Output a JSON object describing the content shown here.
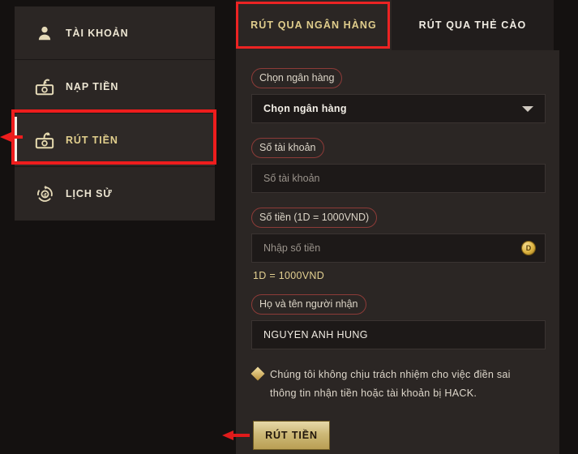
{
  "theme": {
    "page_bg": "#141110",
    "panel_bg": "#2b2624",
    "input_bg": "#1d1918",
    "gold": "#e2cf8d",
    "gold_button_mid": "#cdb977",
    "annotation_red": "#ee1d1d",
    "label_outline": "#8d3b38",
    "text_light": "#ece5d2",
    "placeholder": "#9a938b"
  },
  "sidebar": {
    "items": [
      {
        "label": "TÀI KHOẢN",
        "icon": "user-icon",
        "active": false
      },
      {
        "label": "NẠP TIỀN",
        "icon": "deposit-money-icon",
        "active": false
      },
      {
        "label": "RÚT TIỀN",
        "icon": "withdraw-money-icon",
        "active": true
      },
      {
        "label": "LỊCH SỬ",
        "icon": "history-refresh-icon",
        "active": false
      }
    ]
  },
  "tabs": [
    {
      "label": "RÚT QUA NGÂN HÀNG",
      "active": true
    },
    {
      "label": "RÚT QUA THẺ CÀO",
      "active": false
    }
  ],
  "form": {
    "bank": {
      "label": "Chọn ngân hàng",
      "selected": "Chọn ngân hàng",
      "icon": "chevron-down-icon"
    },
    "account_number": {
      "label": "Số tài khoản",
      "value": "",
      "placeholder": "Số tài khoản"
    },
    "amount": {
      "label": "Số tiền (1D = 1000VND)",
      "value": "",
      "placeholder": "Nhập số tiền",
      "suffix_icon": "coin-icon",
      "suffix_icon_text": "D",
      "hint": "1D = 1000VND"
    },
    "recipient_name": {
      "label": "Họ và tên người nhận",
      "value": "NGUYEN ANH HUNG",
      "placeholder": "Họ và tên người nhận"
    },
    "notice": {
      "bullet_icon": "diamond-bullet-icon",
      "text": "Chúng tôi không chịu trách nhiệm cho việc điền sai thông tin nhận tiền hoặc tài khoản bị HACK."
    },
    "submit_label": "RÚT TIỀN"
  },
  "annotations": {
    "sidebar_highlight": "red-box-around-rut-tien",
    "sidebar_arrow": "red-arrow-left",
    "tab_highlight": "red-box-around-rut-qua-ngan-hang",
    "button_arrow": "red-arrow-left"
  }
}
